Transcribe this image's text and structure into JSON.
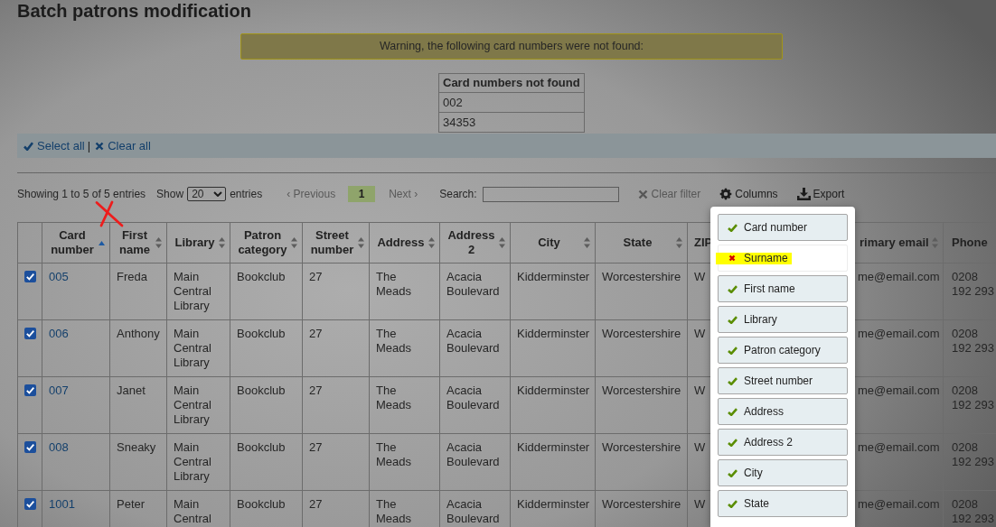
{
  "page": {
    "title": "Batch patrons modification"
  },
  "warning": {
    "message": "Warning, the following card numbers were not found:"
  },
  "not_found": {
    "header": "Card numbers not found",
    "rows": [
      "002",
      "34353"
    ]
  },
  "selection": {
    "select_all": "Select all",
    "separator": "|",
    "clear_all": "Clear all"
  },
  "controls": {
    "info": "Showing 1 to 5 of 5 entries",
    "show_label": "Show",
    "page_size": "20",
    "entries_label": "entries",
    "previous": {
      "label": "‹ Previous",
      "disabled": true
    },
    "pages": [
      {
        "label": "1",
        "selected": true
      }
    ],
    "next": {
      "label": "Next ›",
      "disabled": true
    },
    "search_label": "Search:",
    "clear_filter": {
      "label": "Clear filter",
      "disabled": true
    },
    "columns_button": "Columns",
    "export_button": "Export"
  },
  "table": {
    "columns": [
      {
        "label": "Card number",
        "sorted": true
      },
      {
        "label": "First name",
        "sorted": false
      },
      {
        "label": "Library",
        "sorted": false
      },
      {
        "label": "Patron category",
        "sorted": false
      },
      {
        "label": "Street number",
        "sorted": false
      },
      {
        "label": "Address",
        "sorted": false
      },
      {
        "label": "Address 2",
        "sorted": false
      },
      {
        "label": "City",
        "sorted": false
      },
      {
        "label": "State",
        "sorted": false
      },
      {
        "label": "ZIP"
      },
      {
        "label": "rimary email",
        "sorted": false
      },
      {
        "label": "Phone"
      }
    ],
    "rows": [
      {
        "checked": true,
        "cells": [
          "005",
          "Freda",
          "Main Central Library",
          "Bookclub",
          "27",
          "The Meads",
          "Acacia Boulevard",
          "Kidderminster",
          "Worcestershire",
          "W",
          "me@email.com",
          "0208 192 293"
        ]
      },
      {
        "checked": true,
        "cells": [
          "006",
          "Anthony",
          "Main Central Library",
          "Bookclub",
          "27",
          "The Meads",
          "Acacia Boulevard",
          "Kidderminster",
          "Worcestershire",
          "W",
          "me@email.com",
          "0208 192 293"
        ]
      },
      {
        "checked": true,
        "cells": [
          "007",
          "Janet",
          "Main Central Library",
          "Bookclub",
          "27",
          "The Meads",
          "Acacia Boulevard",
          "Kidderminster",
          "Worcestershire",
          "W",
          "me@email.com",
          "0208 192 293"
        ]
      },
      {
        "checked": true,
        "cells": [
          "008",
          "Sneaky",
          "Main Central Library",
          "Bookclub",
          "27",
          "The Meads",
          "Acacia Boulevard",
          "Kidderminster",
          "Worcestershire",
          "W",
          "me@email.com",
          "0208 192 293"
        ]
      },
      {
        "checked": true,
        "cells": [
          "1001",
          "Peter",
          "Main Central",
          "Bookclub",
          "27",
          "The Meads",
          "Acacia Boulevard",
          "Kidderminster",
          "Worcestershire",
          "W",
          "me@email.com",
          "0208 192 293"
        ]
      }
    ]
  },
  "columns_menu": {
    "items": [
      {
        "label": "Card number",
        "checked": true,
        "highlighted": false
      },
      {
        "label": "Surname",
        "checked": false,
        "highlighted": true
      },
      {
        "label": "First name",
        "checked": true,
        "highlighted": false
      },
      {
        "label": "Library",
        "checked": true,
        "highlighted": false
      },
      {
        "label": "Patron category",
        "checked": true,
        "highlighted": false
      },
      {
        "label": "Street number",
        "checked": true,
        "highlighted": false
      },
      {
        "label": "Address",
        "checked": true,
        "highlighted": false
      },
      {
        "label": "Address 2",
        "checked": true,
        "highlighted": false
      },
      {
        "label": "City",
        "checked": true,
        "highlighted": false
      },
      {
        "label": "State",
        "checked": true,
        "highlighted": false
      }
    ]
  }
}
